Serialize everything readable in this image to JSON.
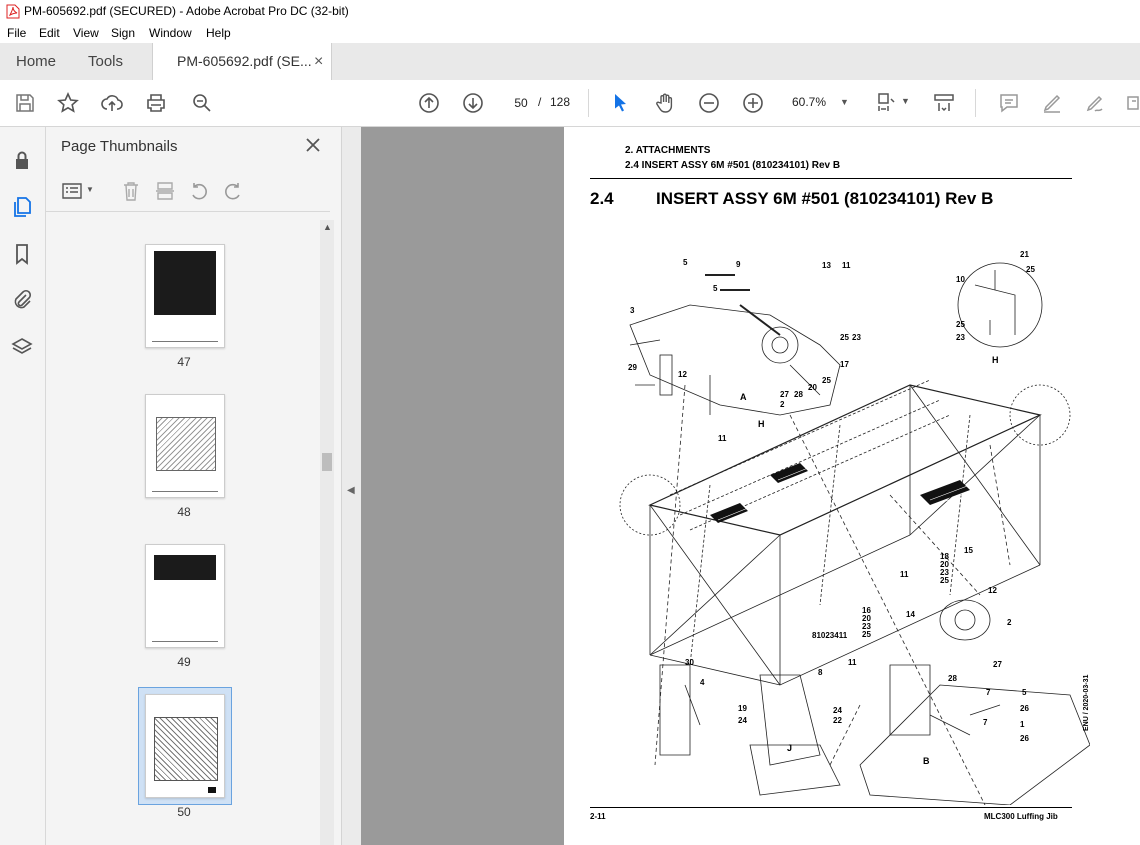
{
  "window": {
    "title": "PM-605692.pdf (SECURED) - Adobe Acrobat Pro DC (32-bit)"
  },
  "menu": {
    "items": [
      "File",
      "Edit",
      "View",
      "Sign",
      "Window",
      "Help"
    ]
  },
  "tabs": {
    "home": "Home",
    "tools": "Tools",
    "document": "PM-605692.pdf (SE...",
    "close": "×"
  },
  "toolbar": {
    "current_page": "50",
    "page_separator": "/",
    "total_pages": "128",
    "zoom": "60.7%"
  },
  "thumbnails": {
    "title": "Page Thumbnails",
    "pages": [
      {
        "label": "47",
        "selected": false
      },
      {
        "label": "48",
        "selected": false
      },
      {
        "label": "49",
        "selected": false
      },
      {
        "label": "50",
        "selected": true
      }
    ]
  },
  "document": {
    "header_line1": "2. ATTACHMENTS",
    "header_line2": "2.4 INSERT ASSY 6M #501 (810234101) Rev B",
    "section_number": "2.4",
    "section_title": "INSERT ASSY 6M #501 (810234101) Rev B",
    "footer_left": "2-11",
    "footer_right": "MLC300 Luffing Jib",
    "side_code": "ENU / 2020-03-31",
    "drawing_number": "81023411",
    "view_labels": [
      "A",
      "H",
      "B",
      "J",
      "H"
    ],
    "callouts": [
      "5",
      "9",
      "13",
      "11",
      "5",
      "3",
      "25",
      "23",
      "29",
      "12",
      "17",
      "25",
      "20",
      "28",
      "27",
      "2",
      "21",
      "25",
      "10",
      "25",
      "23",
      "11",
      "15",
      "18",
      "20",
      "23",
      "25",
      "11",
      "12",
      "2",
      "16",
      "20",
      "23",
      "25",
      "14",
      "27",
      "28",
      "7",
      "5",
      "26",
      "7",
      "1",
      "26",
      "30",
      "4",
      "8",
      "19",
      "24",
      "24",
      "22",
      "11"
    ]
  },
  "colors": {
    "accent": "#1473e6",
    "page_bg": "#9a9a9a",
    "panel_bg": "#f4f4f4"
  }
}
